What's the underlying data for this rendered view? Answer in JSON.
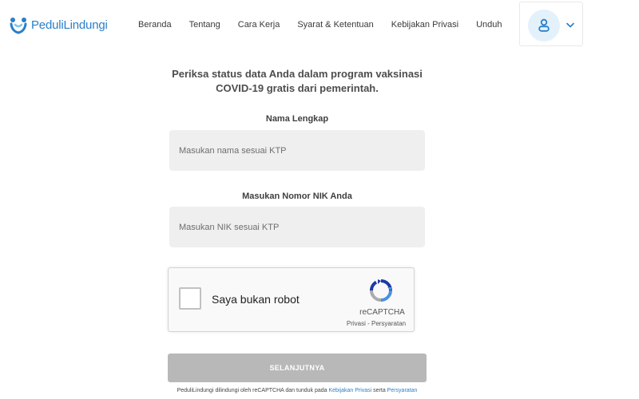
{
  "brand": {
    "name": "PeduliLindungi",
    "color": "#2a7fc9"
  },
  "nav": {
    "items": [
      {
        "label": "Beranda"
      },
      {
        "label": "Tentang"
      },
      {
        "label": "Cara Kerja"
      },
      {
        "label": "Syarat & Ketentuan"
      },
      {
        "label": "Kebijakan Privasi"
      },
      {
        "label": "Unduh"
      }
    ]
  },
  "user_menu": {
    "icon": "user-icon",
    "caret_icon": "chevron-down-icon",
    "avatar_bg": "#e3f1fb"
  },
  "form": {
    "intro_line1": "Periksa status data Anda dalam program vaksinasi",
    "intro_line2": "COVID-19 gratis dari pemerintah.",
    "name_label": "Nama Lengkap",
    "name_value": "",
    "name_placeholder": "Masukan nama sesuai KTP",
    "nik_label": "Masukan Nomor NIK Anda",
    "nik_value": "",
    "nik_placeholder": "Masukan NIK sesuai KTP",
    "submit_label": "SELANJUTNYA",
    "submit_color": "#b8b8b8"
  },
  "captcha": {
    "label": "Saya bukan robot",
    "brand": "reCAPTCHA",
    "privacy_link": "Privasi",
    "separator": " - ",
    "terms_link": "Persyaratan",
    "checked": false
  },
  "footnote": {
    "text_before": "PeduliLindungi dilindungi oleh reCAPTCHA dan tunduk pada ",
    "privacy_link": "Kebijakan Privasi",
    "text_middle": " serta ",
    "terms_link": "Persyaratan"
  }
}
